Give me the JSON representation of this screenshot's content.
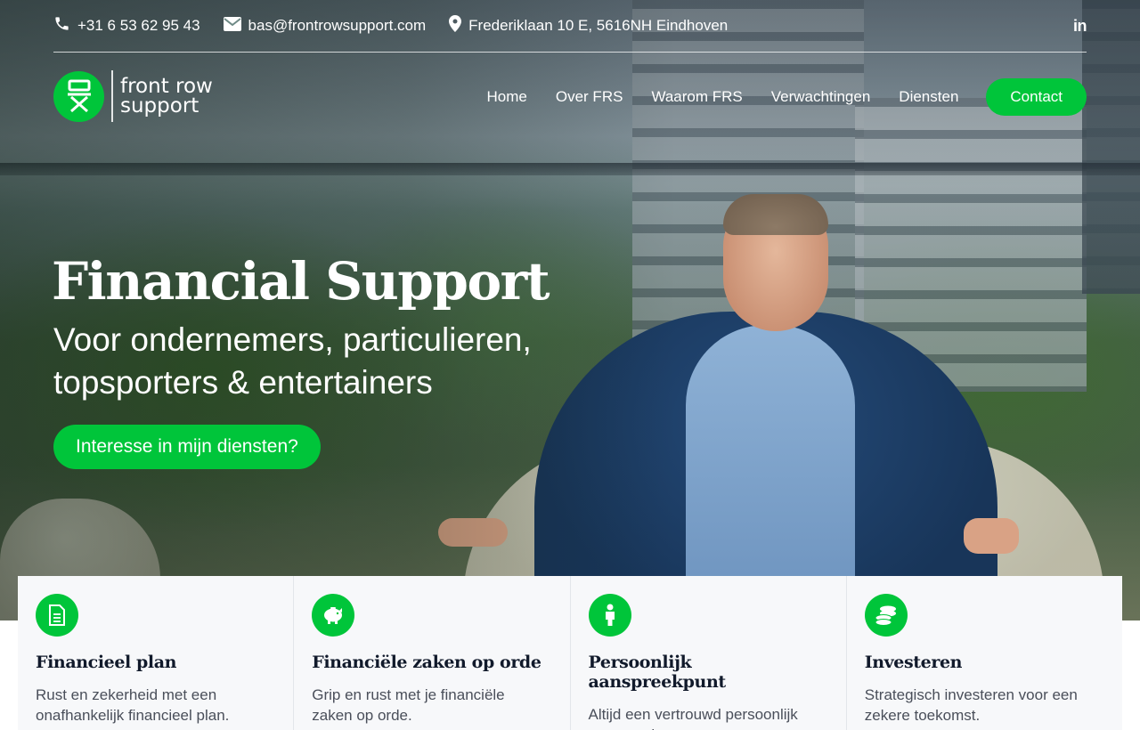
{
  "topbar": {
    "phone": "+31 6 53 62 95 43",
    "email": "bas@frontrowsupport.com",
    "address": "Frederiklaan 10 E, 5616NH Eindhoven",
    "linkedin_label": "in"
  },
  "logo": {
    "line1": "front row",
    "line2": "support"
  },
  "nav": {
    "items": [
      "Home",
      "Over FRS",
      "Waarom FRS",
      "Verwachtingen",
      "Diensten"
    ],
    "contact_label": "Contact"
  },
  "hero": {
    "title": "Financial Support",
    "subtitle": "Voor ondernemers, particulieren, topsporters & entertainers",
    "cta_label": "Interesse in mijn diensten?"
  },
  "cards": [
    {
      "icon": "document-icon",
      "title": "Financieel plan",
      "text": "Rust en zekerheid met een onafhankelijk financieel plan."
    },
    {
      "icon": "piggy-bank-icon",
      "title": "Financiële zaken op orde",
      "text": "Grip en rust met je financiële zaken op orde."
    },
    {
      "icon": "person-icon",
      "title": "Persoonlijk aanspreekpunt",
      "text": "Altijd een vertrouwd persoonlijk aanspreekpunt."
    },
    {
      "icon": "coins-icon",
      "title": "Investeren",
      "text": "Strategisch investeren voor een zekere toekomst."
    }
  ],
  "colors": {
    "accent": "#00c53a",
    "heading": "#111a2b",
    "body_text": "#4a4f5a",
    "card_bg": "#f7f8fa"
  }
}
